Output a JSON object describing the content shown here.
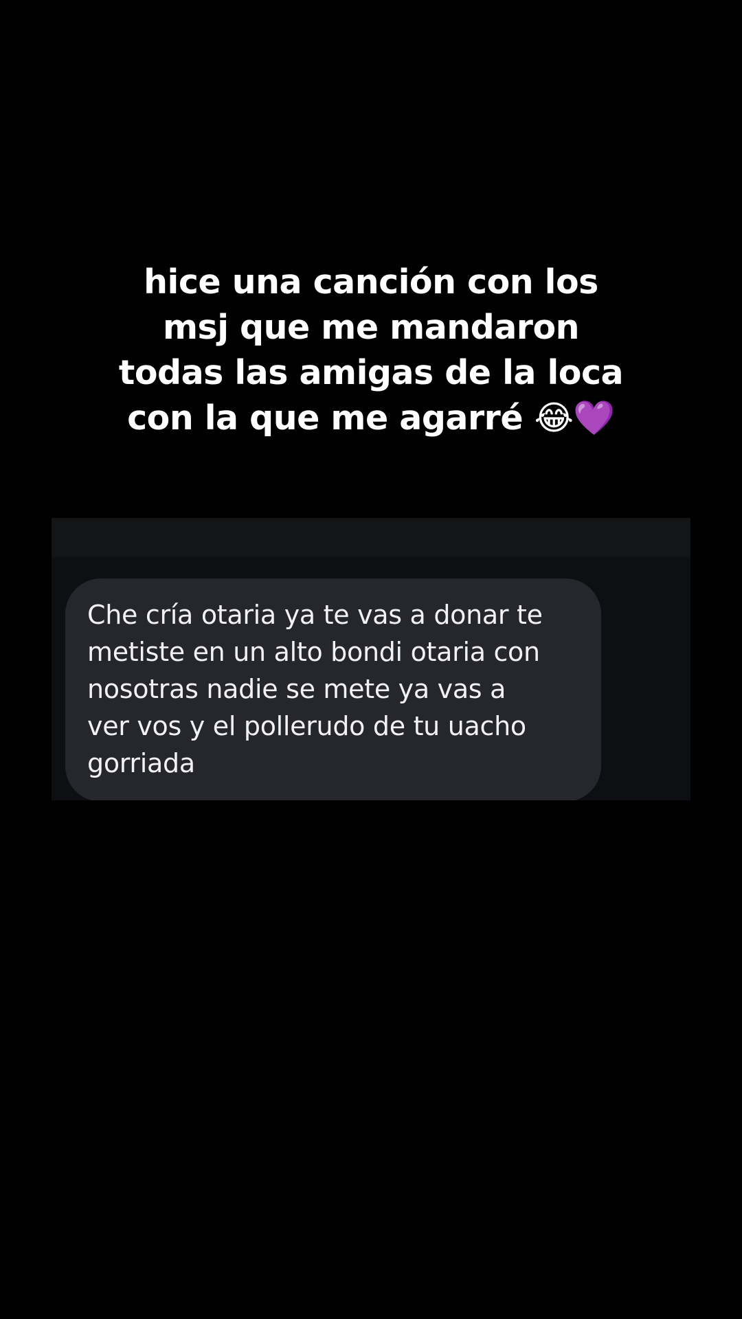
{
  "caption": {
    "lines": [
      "hice una canción con los",
      "msj que me mandaron",
      "todas las amigas de la loca",
      "con la que me agarré 😂💜"
    ]
  },
  "message": {
    "lines": [
      "Che cría otaria ya te vas a donar te",
      "metiste en un alto bondi otaria con",
      "nosotras nadie se mete ya vas a",
      "ver vos y el pollerudo de tu uacho",
      "gorriada"
    ]
  },
  "colors": {
    "background": "#000000",
    "caption_text": "#ffffff",
    "bubble": "#25272c",
    "bubble_text": "#f2f2f4"
  }
}
